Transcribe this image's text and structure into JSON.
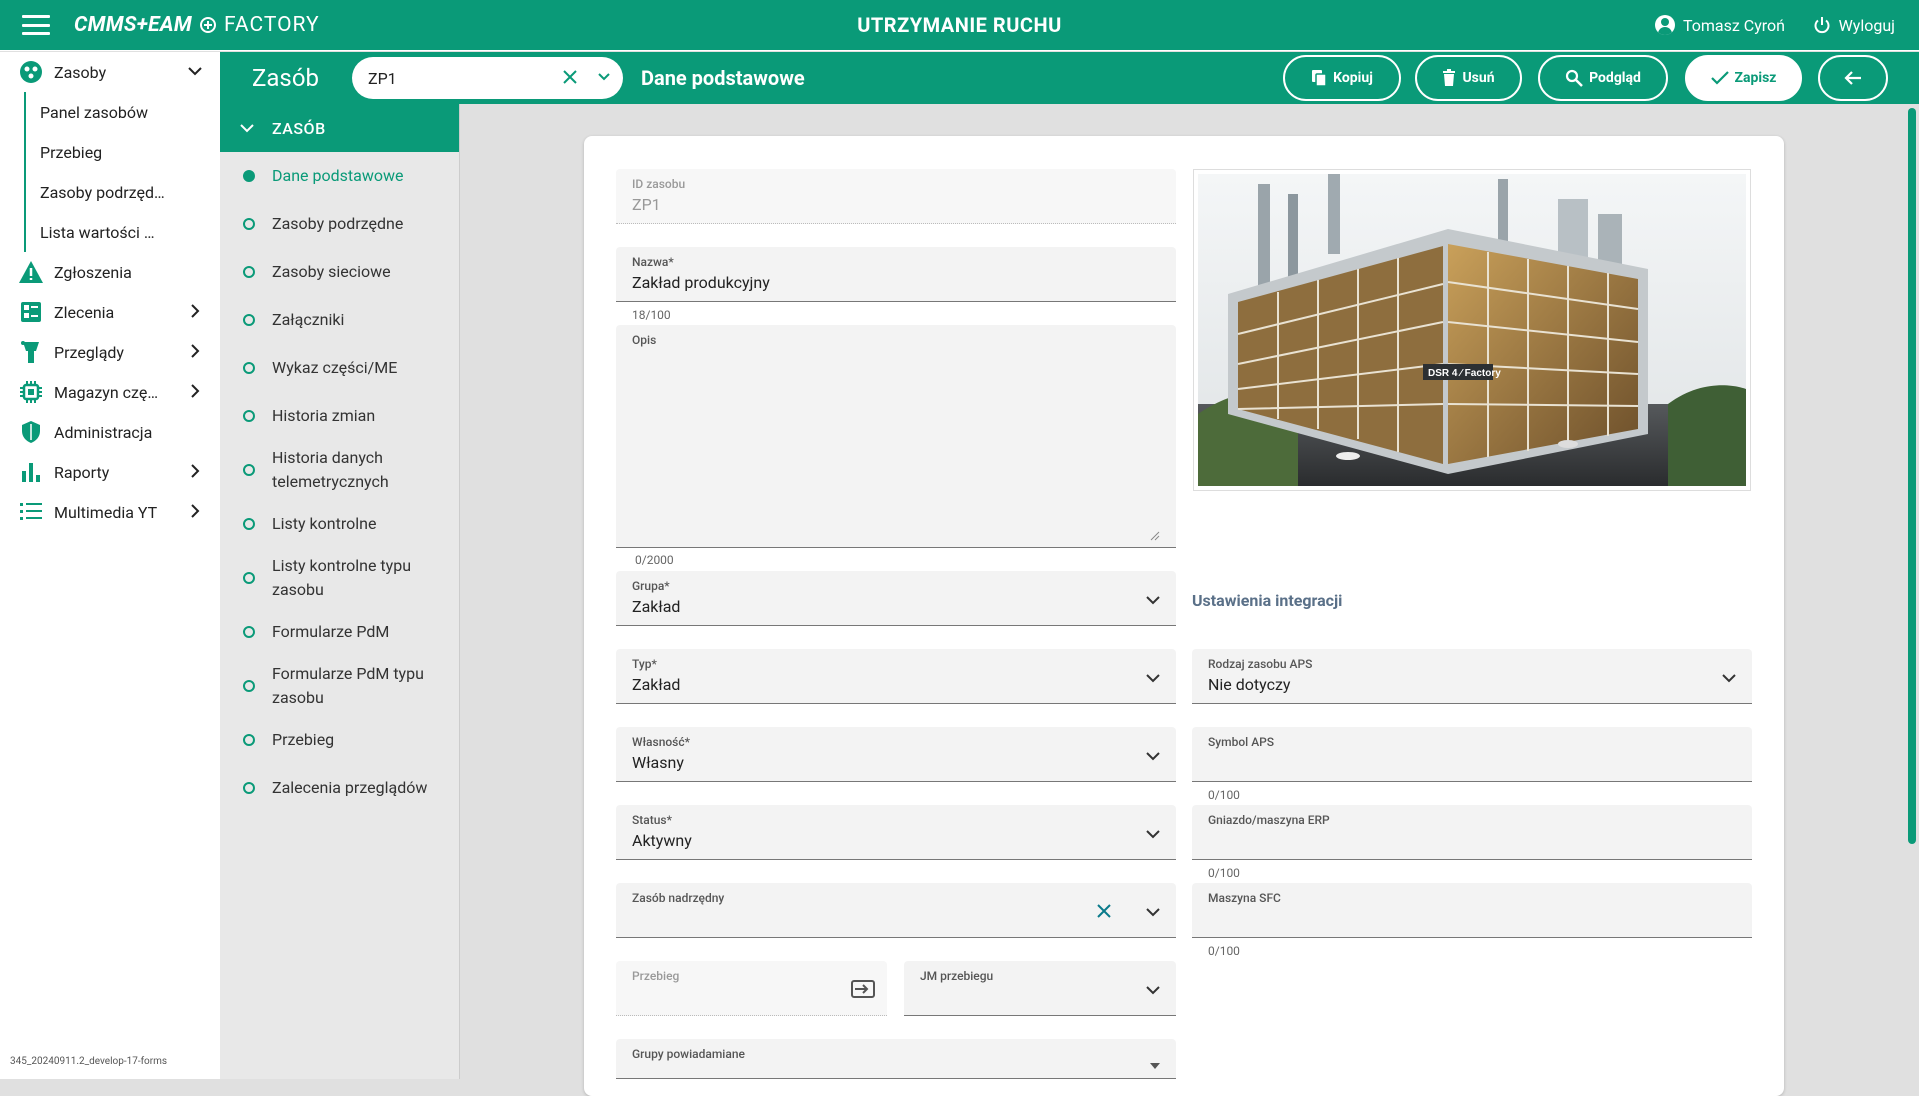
{
  "topbar": {
    "logo": "CMMS+EAM",
    "logo2": "FACTORY",
    "title": "UTRZYMANIE RUCHU",
    "user": "Tomasz Cyroń",
    "logout": "Wyloguj"
  },
  "sidebar": {
    "zasoby": "Zasoby",
    "sub": [
      "Panel zasobów",
      "Przebieg",
      "Zasoby podrzęd…",
      "Lista wartości …"
    ],
    "items": [
      "Zgłoszenia",
      "Zlecenia",
      "Przeglądy",
      "Magazyn czę…",
      "Administracja",
      "Raporty",
      "Multimedia YT"
    ],
    "version": "345_20240911.2_develop-17-forms"
  },
  "subheader": {
    "title": "Zasób",
    "combo_value": "ZP1",
    "section": "Dane podstawowe",
    "buttons": {
      "copy": "Kopiuj",
      "delete": "Usuń",
      "preview": "Podgląd",
      "save": "Zapisz"
    }
  },
  "nav": {
    "head": "ZASÓB",
    "items": [
      "Dane podstawowe",
      "Zasoby podrzędne",
      "Zasoby sieciowe",
      "Załączniki",
      "Wykaz części/ME",
      "Historia zmian",
      "Historia danych telemetrycznych",
      "Listy kontrolne",
      "Listy kontrolne typu zasobu",
      "Formularze PdM",
      "Formularze PdM typu zasobu",
      "Przebieg",
      "Zalecenia przeglądów"
    ]
  },
  "form": {
    "id": {
      "label": "ID zasobu",
      "value": "ZP1"
    },
    "name": {
      "label": "Nazwa*",
      "value": "Zakład produkcyjny",
      "counter": "18/100"
    },
    "desc": {
      "label": "Opis",
      "counter": "0/2000"
    },
    "group": {
      "label": "Grupa*",
      "value": "Zakład"
    },
    "type": {
      "label": "Typ*",
      "value": "Zakład"
    },
    "ownership": {
      "label": "Własność*",
      "value": "Własny"
    },
    "status": {
      "label": "Status*",
      "value": "Aktywny"
    },
    "parent": {
      "label": "Zasób nadrzędny"
    },
    "mileage": {
      "label": "Przebieg"
    },
    "mileage_unit": {
      "label": "JM przebiegu"
    },
    "notify": {
      "label": "Grupy powiadamiane"
    },
    "integration_title": "Ustawienia integracji",
    "aps_type": {
      "label": "Rodzaj zasobu APS",
      "value": "Nie dotyczy"
    },
    "aps_symbol": {
      "label": "Symbol APS",
      "counter": "0/100"
    },
    "erp": {
      "label": "Gniazdo/maszyna ERP",
      "counter": "0/100"
    },
    "sfc": {
      "label": "Maszyna SFC",
      "counter": "0/100"
    },
    "image_sign": "DSR 4 ⁄ Factory"
  }
}
